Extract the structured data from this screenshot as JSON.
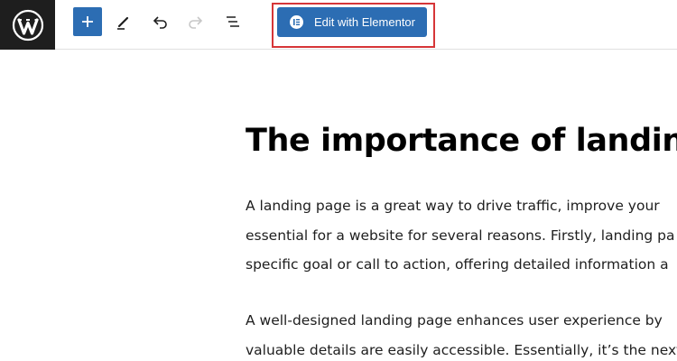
{
  "toolbar": {
    "logo_icon": "wordpress-logo-icon",
    "add_block_icon": "plus-icon",
    "tools_icon": "pencil-icon",
    "undo_icon": "undo-icon",
    "redo_icon": "redo-icon",
    "list_view_icon": "list-view-icon",
    "elementor_button_label": "Edit with Elementor",
    "elementor_icon": "elementor-icon",
    "highlight_color": "#d63638",
    "accent_color": "#2c6db3"
  },
  "post": {
    "title": "The importance of landing p",
    "paragraphs": [
      {
        "lines": [
          " A landing page is a great way to drive traffic, improve your",
          "essential for a website for several reasons. Firstly, landing pa",
          "specific goal or call to action, offering detailed information a"
        ]
      },
      {
        "lines": [
          "A well-designed landing page enhances user experience by",
          "valuable details are easily accessible. Essentially, it’s the next"
        ]
      }
    ]
  }
}
